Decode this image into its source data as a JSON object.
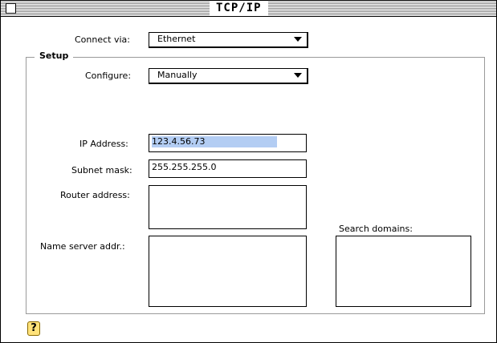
{
  "window": {
    "title": "TCP/IP"
  },
  "connect": {
    "label": "Connect via:",
    "value": "Ethernet"
  },
  "setup": {
    "title": "Setup",
    "configure_label": "Configure:",
    "configure_value": "Manually",
    "ip_label": "IP Address:",
    "ip_value": "123.4.56.73",
    "subnet_label": "Subnet mask:",
    "subnet_value": "255.255.255.0",
    "router_label": "Router address:",
    "router_value": "",
    "nameserver_label": "Name server addr.:",
    "nameserver_value": "",
    "search_label": "Search domains:",
    "search_value": ""
  },
  "help": {
    "icon": "help-icon",
    "glyph": "?"
  }
}
